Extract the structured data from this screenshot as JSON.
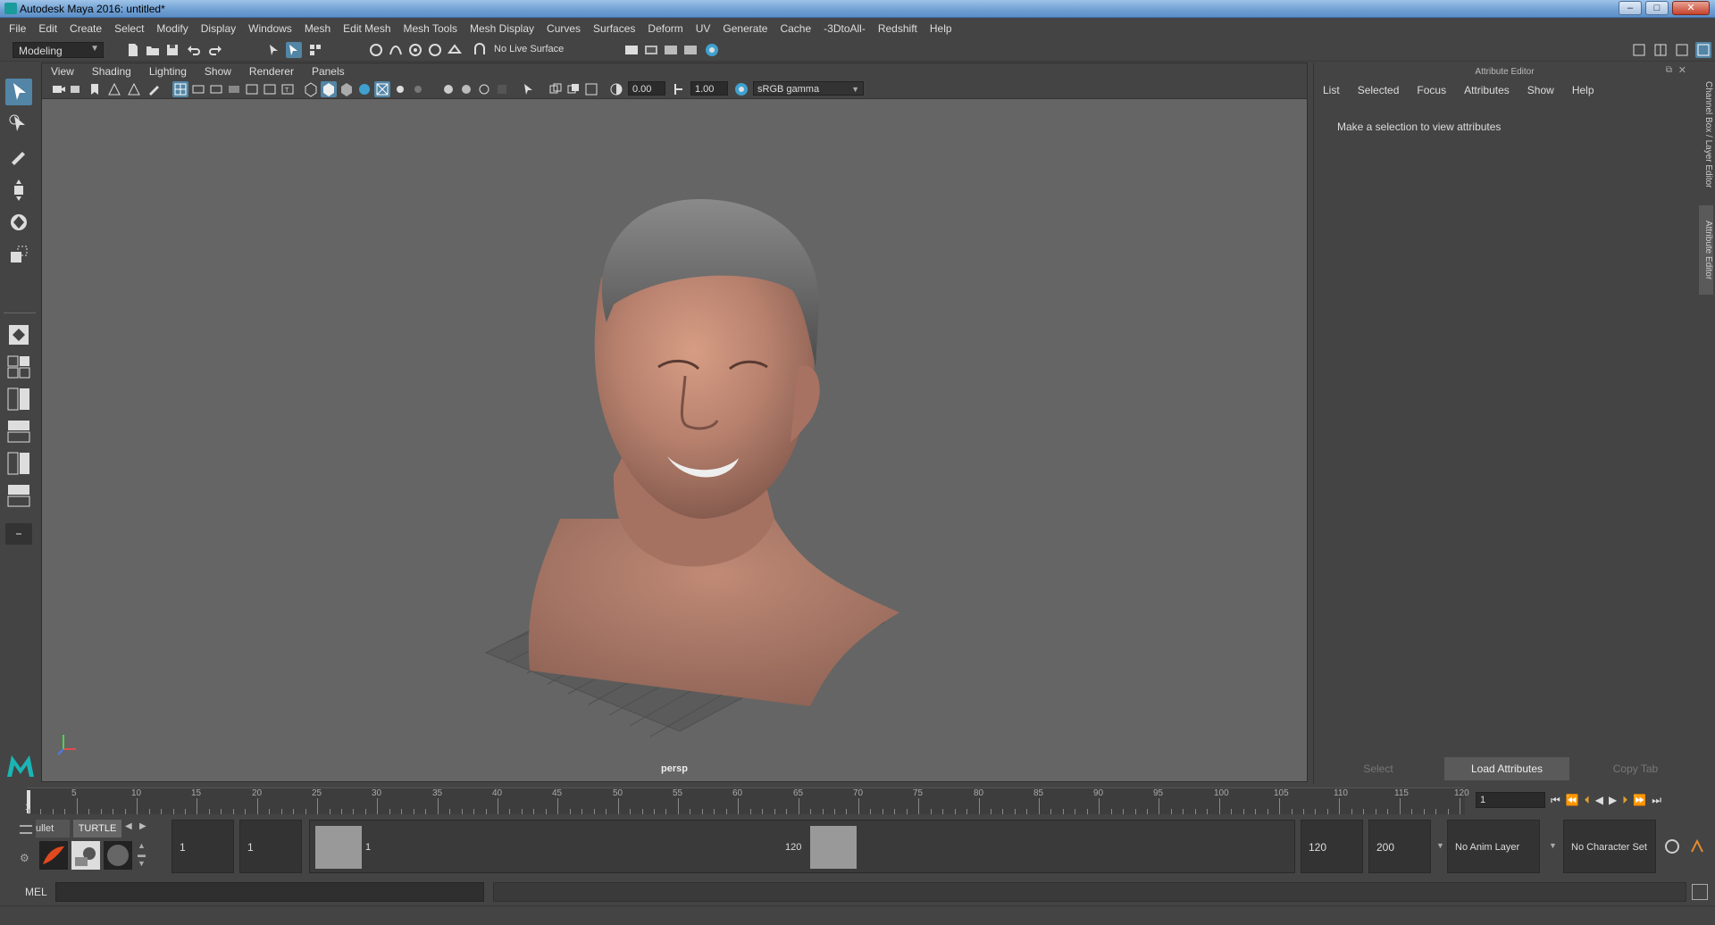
{
  "titlebar": {
    "title": "Autodesk Maya 2016: untitled*",
    "buttons": [
      "–",
      "□",
      "✕"
    ]
  },
  "menubar": [
    "File",
    "Edit",
    "Create",
    "Select",
    "Modify",
    "Display",
    "Windows",
    "Mesh",
    "Edit Mesh",
    "Mesh Tools",
    "Mesh Display",
    "Curves",
    "Surfaces",
    "Deform",
    "UV",
    "Generate",
    "Cache",
    "-3DtoAll-",
    "Redshift",
    "Help"
  ],
  "statusline": {
    "menuset": "Modeling",
    "live_surface": "No Live Surface"
  },
  "viewport": {
    "menu": [
      "View",
      "Shading",
      "Lighting",
      "Show",
      "Renderer",
      "Panels"
    ],
    "exposure": "0.00",
    "gamma": "1.00",
    "color_space": "sRGB gamma",
    "camera": "persp"
  },
  "attribute_editor": {
    "header": "Attribute Editor",
    "menu": [
      "List",
      "Selected",
      "Focus",
      "Attributes",
      "Show",
      "Help"
    ],
    "message": "Make a selection to view attributes",
    "buttons": {
      "select": "Select",
      "load": "Load Attributes",
      "copy": "Copy Tab"
    },
    "side_tabs": [
      "Channel Box / Layer Editor",
      "Attribute Editor"
    ]
  },
  "timeline": {
    "ticks": [
      "5",
      "10",
      "15",
      "20",
      "25",
      "30",
      "35",
      "40",
      "45",
      "50",
      "55",
      "60",
      "65",
      "70",
      "75",
      "80",
      "85",
      "90",
      "95",
      "100",
      "105",
      "110",
      "115",
      "120"
    ],
    "start_label": "1",
    "current_frame": "1"
  },
  "range": {
    "shelf_tabs": [
      "ullet",
      "TURTLE"
    ],
    "start": "1",
    "playback_start": "1",
    "slider_start": "1",
    "slider_end": "120",
    "playback_end": "120",
    "end": "200",
    "anim_layer": "No Anim Layer",
    "char_set": "No Character Set"
  },
  "cmd": {
    "label": "MEL"
  }
}
